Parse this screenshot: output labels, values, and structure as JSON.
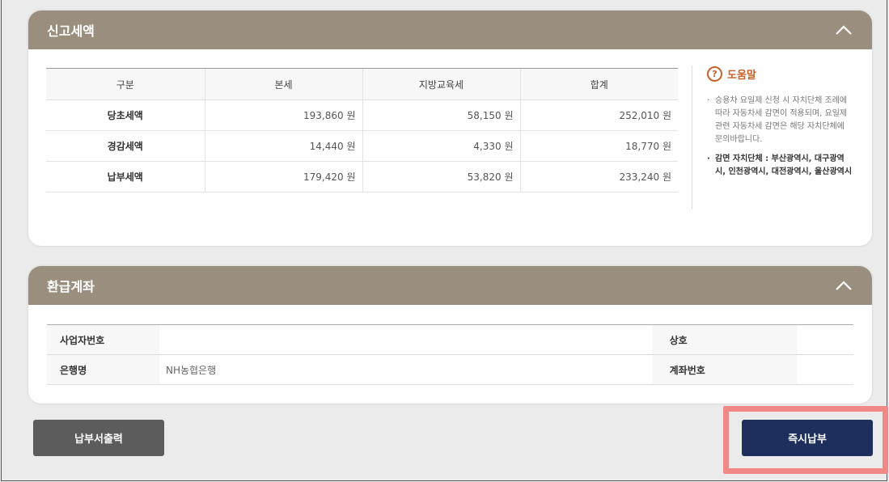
{
  "tax_panel": {
    "title": "신고세액",
    "headers": [
      "구분",
      "본세",
      "지방교육세",
      "합계"
    ],
    "rows": [
      {
        "label": "당초세액",
        "main_tax": "193,860 원",
        "edu_tax": "58,150 원",
        "total": "252,010 원"
      },
      {
        "label": "경감세액",
        "main_tax": "14,440 원",
        "edu_tax": "4,330 원",
        "total": "18,770 원"
      },
      {
        "label": "납부세액",
        "main_tax": "179,420 원",
        "edu_tax": "53,820 원",
        "total": "233,240 원"
      }
    ]
  },
  "help": {
    "icon": "?",
    "title": "도움말",
    "items": [
      "승용차 요일제 신청 시 자치단체 조례에 따라 자동차세 감면이 적용되며, 요일제 관련 자동차세 감면은 해당 자치단체에 문의바랍니다.",
      "감면 자치단체 : 부산광역시, 대구광역시, 인천광역시, 대전광역시, 울산광역시"
    ]
  },
  "refund_panel": {
    "title": "환급계좌",
    "biz_no_label": "사업자번호",
    "biz_no_value": "",
    "company_label": "상호",
    "company_value": "",
    "bank_label": "은행명",
    "bank_value": "NH농협은행",
    "account_label": "계좌번호",
    "account_value": ""
  },
  "buttons": {
    "print": "납부서출력",
    "pay": "즉시납부"
  },
  "colors": {
    "panel_header": "#9a8f7e",
    "pay_button": "#1e2f5e",
    "print_button": "#5c5c5c",
    "highlight": "#f08888",
    "help_accent": "#c65f2a"
  },
  "icons": {
    "collapse": "chevron-up-icon",
    "help": "question-circle-icon"
  }
}
